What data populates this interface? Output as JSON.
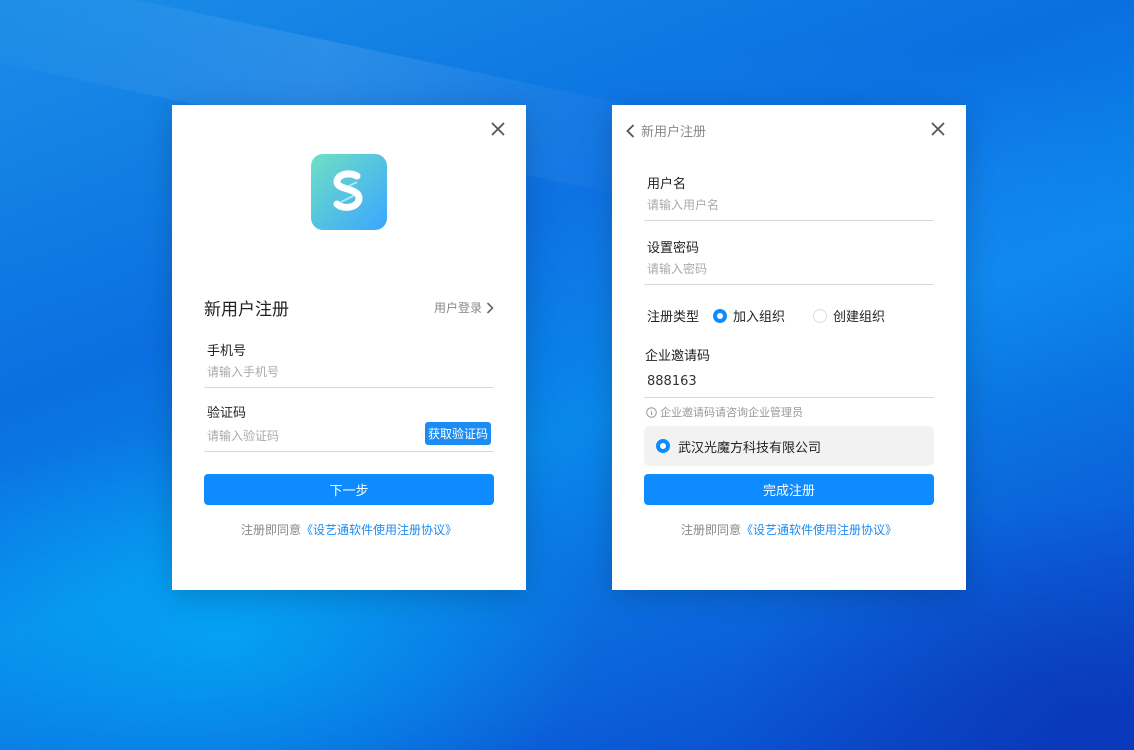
{
  "left_card": {
    "title": "新用户注册",
    "login_link": "用户登录",
    "phone": {
      "label": "手机号",
      "placeholder": "请输入手机号",
      "value": ""
    },
    "code": {
      "label": "验证码",
      "placeholder": "请输入验证码",
      "value": "",
      "button": "获取验证码"
    },
    "next_button": "下一步",
    "agreement_prefix": "注册即同意",
    "agreement_link": "《设艺通软件使用注册协议》"
  },
  "right_card": {
    "back_label": "新用户注册",
    "username": {
      "label": "用户名",
      "placeholder": "请输入用户名",
      "value": ""
    },
    "password": {
      "label": "设置密码",
      "placeholder": "请输入密码",
      "value": ""
    },
    "type": {
      "label": "注册类型",
      "options": [
        {
          "label": "加入组织",
          "checked": true
        },
        {
          "label": "创建组织",
          "checked": false
        }
      ]
    },
    "invite": {
      "label": "企业邀请码",
      "value": "888163",
      "hint": "企业邀请码请咨询企业管理员"
    },
    "company": {
      "name": "武汉光魔方科技有限公司",
      "selected": true
    },
    "finish_button": "完成注册",
    "agreement_prefix": "注册即同意",
    "agreement_link": "《设艺通软件使用注册协议》"
  },
  "colors": {
    "primary": "#0d8bff",
    "link": "#1c8cf2",
    "logo_start": "#6fe0c4",
    "logo_end": "#3aa6ff"
  }
}
